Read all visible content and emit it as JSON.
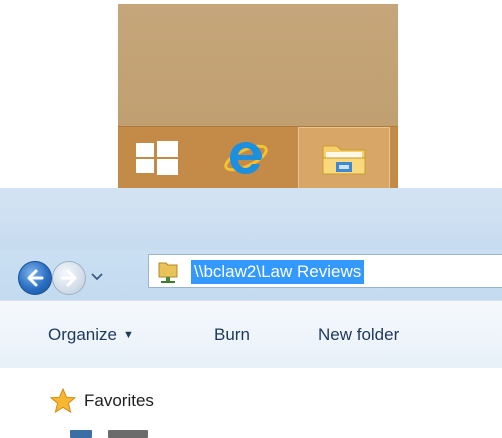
{
  "taskbar": {
    "start_button": {
      "icon": "windows-logo-icon"
    },
    "ie_button": {
      "icon": "internet-explorer-icon"
    },
    "explorer_button": {
      "icon": "file-explorer-folder-icon",
      "active": true
    }
  },
  "navigation": {
    "back_icon": "back-arrow-icon",
    "forward_icon": "forward-arrow-icon",
    "recent_icon": "chevron-down-icon",
    "address": {
      "icon": "network-folder-icon",
      "value": "\\\\bclaw2\\Law Reviews"
    }
  },
  "toolbar": {
    "organize_label": "Organize",
    "burn_label": "Burn",
    "new_folder_label": "New folder"
  },
  "nav_pane": {
    "favorites_label": "Favorites",
    "favorites_icon": "star-icon"
  },
  "colors": {
    "taskbar": "#c48a48",
    "desktop": "#c5a67a",
    "selection": "#3399ff",
    "toolbar_text": "#1e395b"
  }
}
